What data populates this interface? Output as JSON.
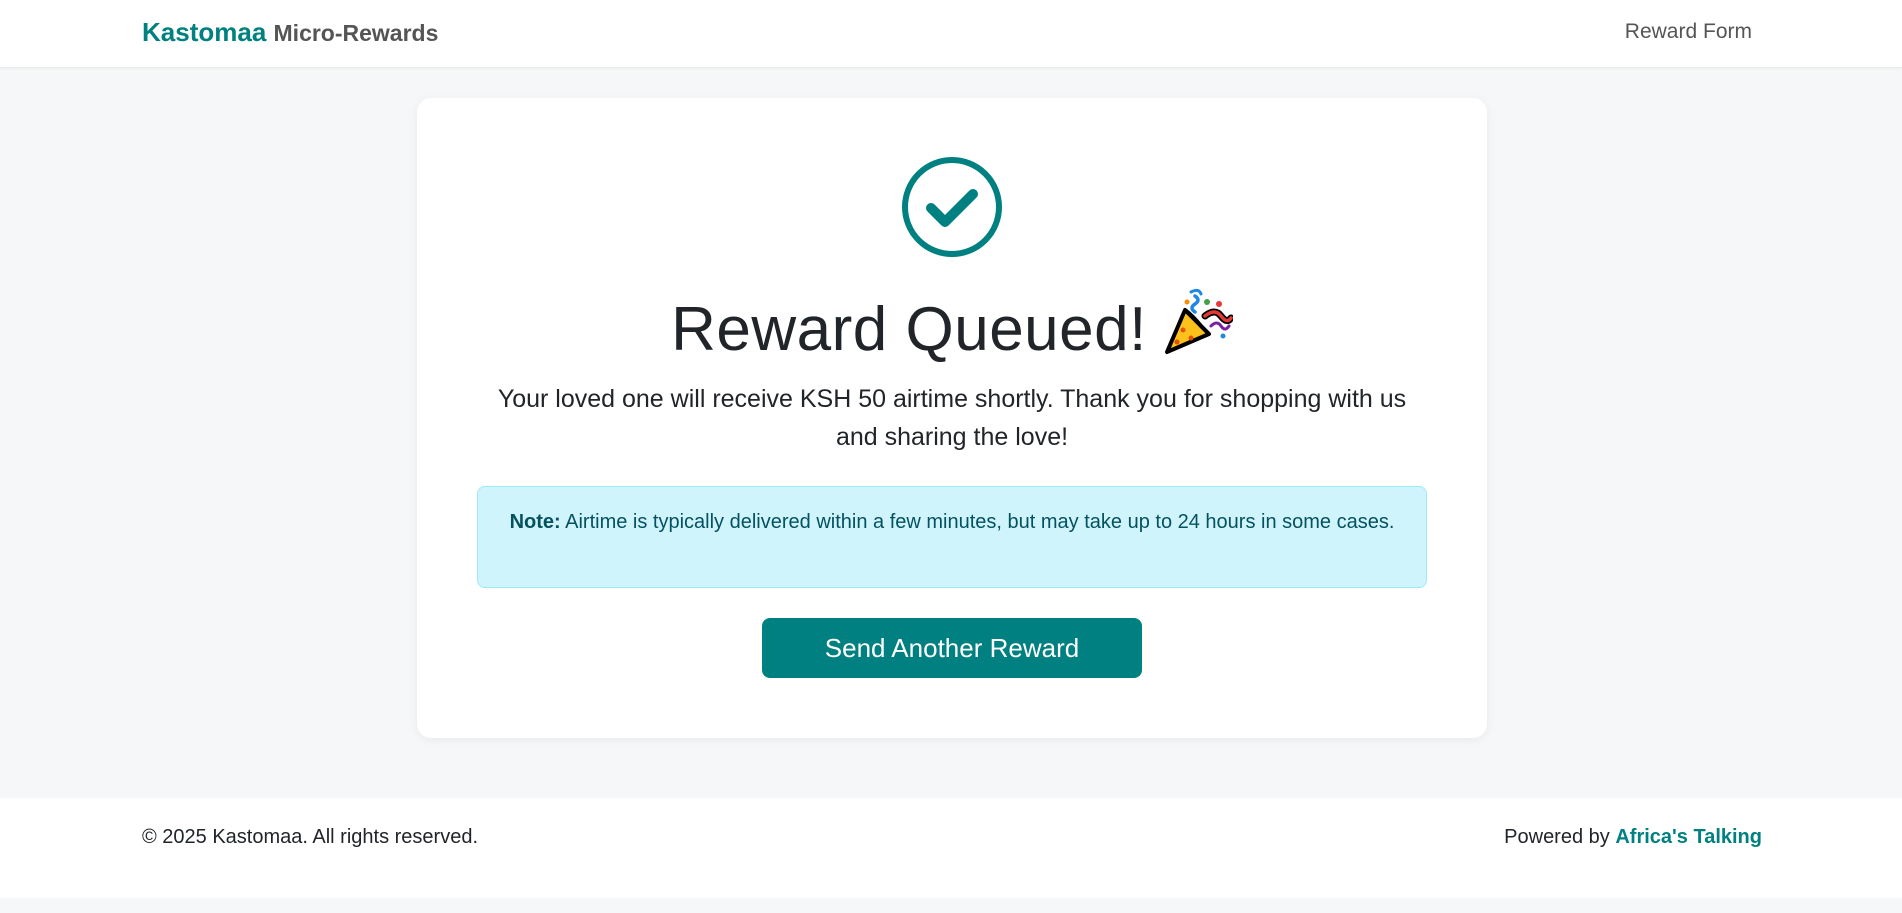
{
  "nav": {
    "brand_primary": "Kastomaa",
    "brand_secondary": "Micro-Rewards",
    "link_reward_form": "Reward Form"
  },
  "card": {
    "icon": "check-circle-icon",
    "title": "Reward Queued!",
    "title_icon": "party-popper-icon",
    "message": "Your loved one will receive KSH 50 airtime shortly. Thank you for shopping with us and sharing the love!",
    "note_label": "Note:",
    "note_text": "Airtime is typically delivered within a few minutes, but may take up to 24 hours in some cases.",
    "button_label": "Send Another Reward"
  },
  "footer": {
    "copyright": "© 2025 Kastomaa. All rights reserved.",
    "powered_prefix": "Powered by",
    "powered_link": "Africa's Talking"
  },
  "colors": {
    "accent": "#008080",
    "note_bg": "#cff4fc",
    "note_text": "#055160",
    "page_bg": "#f5f7f8"
  }
}
